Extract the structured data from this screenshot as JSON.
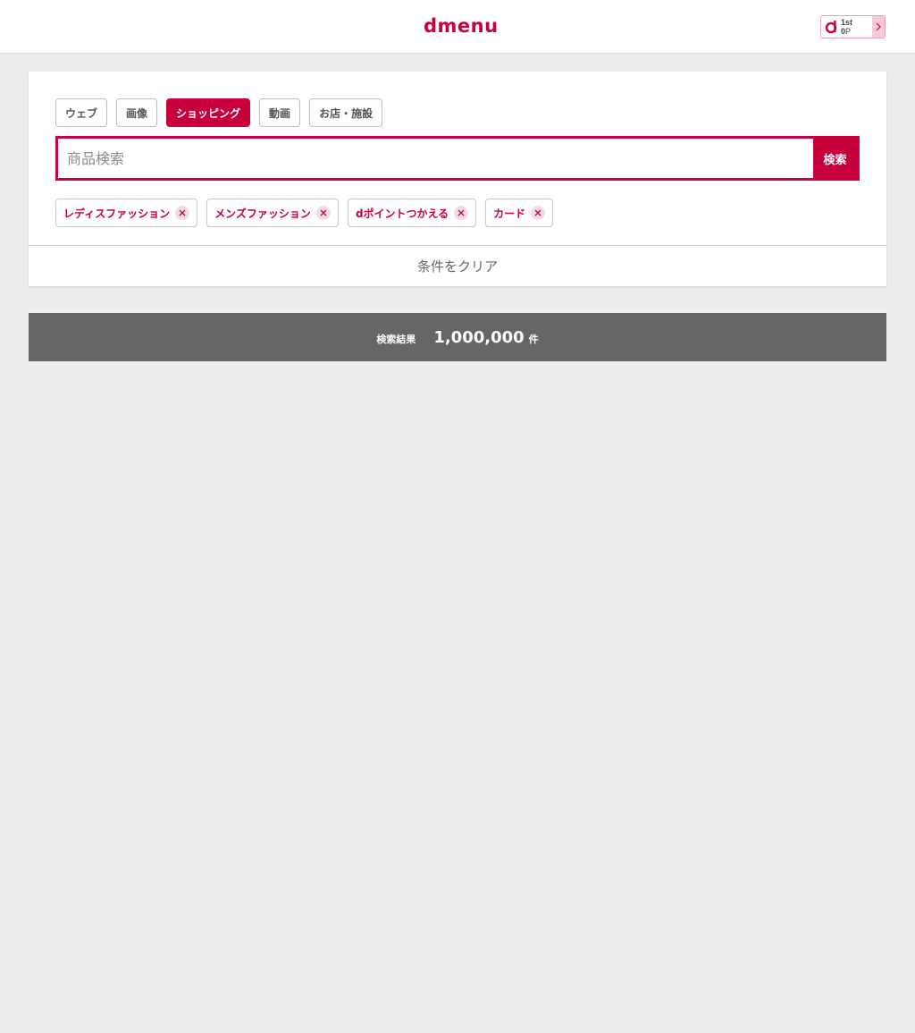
{
  "header": {
    "logo_text": "dmenu",
    "points": {
      "rank": "1st",
      "value": "0",
      "unit": "P"
    }
  },
  "search": {
    "tabs": [
      {
        "label": "ウェブ",
        "active": false
      },
      {
        "label": "画像",
        "active": false
      },
      {
        "label": "ショッピング",
        "active": true
      },
      {
        "label": "動画",
        "active": false
      },
      {
        "label": "お店・施設",
        "active": false
      }
    ],
    "input_value": "",
    "placeholder": "商品検索",
    "button_label": "検索",
    "filters": [
      {
        "label": "レディスファッション"
      },
      {
        "label": "メンズファッション"
      },
      {
        "label": "dポイントつかえる"
      },
      {
        "label": "カード"
      }
    ],
    "clear_label": "条件をクリア"
  },
  "results": {
    "label": "検索結果",
    "count": "1,000,000",
    "unit": "件"
  },
  "colors": {
    "brand": "#c8003c",
    "result_bar": "#666666",
    "page_bg": "#ededed"
  }
}
